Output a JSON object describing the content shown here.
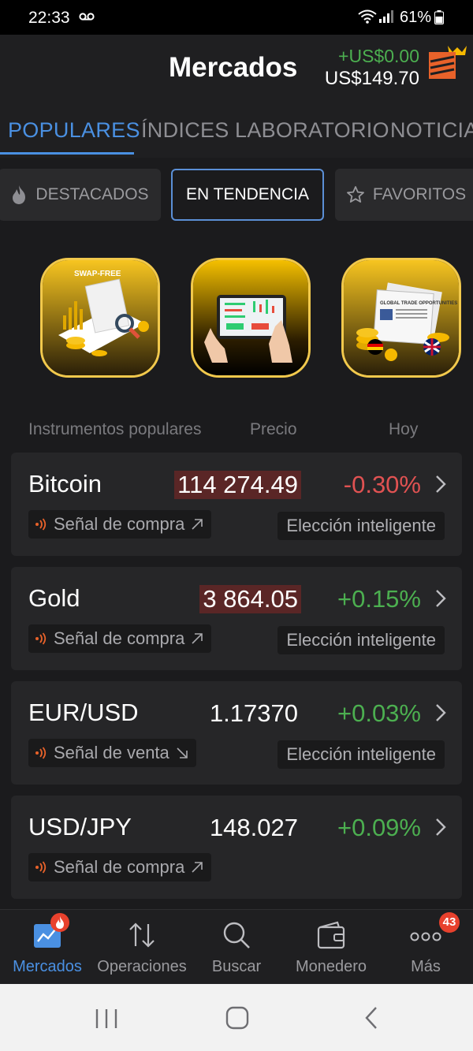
{
  "status": {
    "time": "22:33",
    "battery": "61%"
  },
  "header": {
    "title": "Mercados",
    "profit": "+US$0.00",
    "balance": "US$149.70"
  },
  "tabs": [
    {
      "label": "POPULARES",
      "active": true
    },
    {
      "label": "ÍNDICES",
      "active": false
    },
    {
      "label": "LABORATORIO",
      "active": false
    },
    {
      "label": "NOTICIA",
      "active": false
    }
  ],
  "segments": [
    {
      "label": "DESTACADOS",
      "icon": "fire-icon",
      "active": false
    },
    {
      "label": "EN TENDENCIA",
      "icon": "",
      "active": true
    },
    {
      "label": "FAVORITOS",
      "icon": "star-icon",
      "active": false
    }
  ],
  "promos": [
    {
      "name": "swap-free",
      "label": "SWAP-FREE"
    },
    {
      "name": "tablet-trading",
      "label": ""
    },
    {
      "name": "trade-opportunities",
      "label": "GLOBAL TRADE OPPORTUNITIES"
    }
  ],
  "list_header": {
    "instrument": "Instrumentos populares",
    "price": "Precio",
    "today": "Hoy"
  },
  "instruments": [
    {
      "name": "Bitcoin",
      "price": "114 274.49",
      "highlight": true,
      "change": "-0.30%",
      "direction": "neg",
      "signal": "Señal de compra",
      "signal_dir": "up",
      "smart": "Elección inteligente"
    },
    {
      "name": "Gold",
      "price": "3 864.05",
      "highlight": true,
      "change": "+0.15%",
      "direction": "pos",
      "signal": "Señal de compra",
      "signal_dir": "up",
      "smart": "Elección inteligente"
    },
    {
      "name": "EUR/USD",
      "price": "1.17370",
      "highlight": false,
      "change": "+0.03%",
      "direction": "pos",
      "signal": "Señal de venta",
      "signal_dir": "down",
      "smart": "Elección inteligente"
    },
    {
      "name": "USD/JPY",
      "price": "148.027",
      "highlight": false,
      "change": "+0.09%",
      "direction": "pos",
      "signal": "Señal de compra",
      "signal_dir": "up",
      "smart": ""
    }
  ],
  "bottom_nav": [
    {
      "label": "Mercados",
      "icon": "chart-icon",
      "active": true
    },
    {
      "label": "Operaciones",
      "icon": "arrows-updown-icon",
      "active": false
    },
    {
      "label": "Buscar",
      "icon": "search-icon",
      "active": false
    },
    {
      "label": "Monedero",
      "icon": "wallet-icon",
      "active": false
    },
    {
      "label": "Más",
      "icon": "more-icon",
      "active": false
    }
  ],
  "more_badge": "43",
  "colors": {
    "accent": "#4a90e2",
    "positive": "#4caf50",
    "negative": "#e05252",
    "price_highlight": "#5a2626",
    "promo_border": "#f2c94c"
  }
}
